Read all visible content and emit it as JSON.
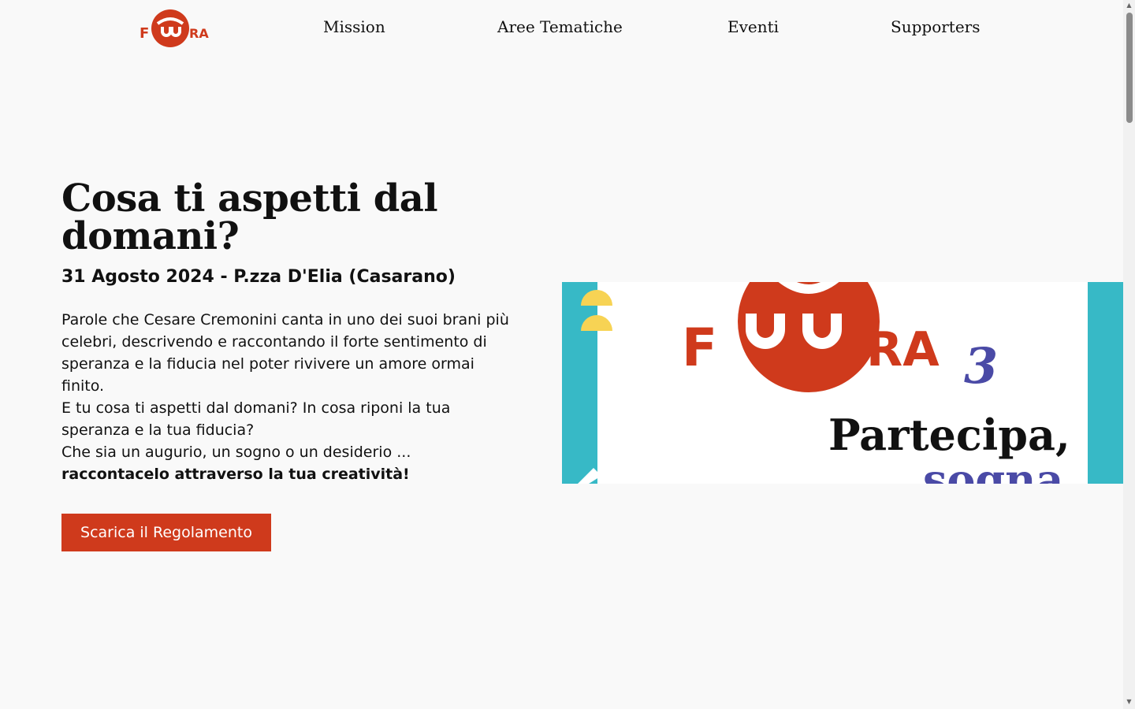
{
  "header": {
    "logo_text": "FUTURA",
    "nav": [
      {
        "label": "Mission"
      },
      {
        "label": "Aree Tematiche"
      },
      {
        "label": "Eventi"
      },
      {
        "label": "Supporters"
      }
    ]
  },
  "hero": {
    "title": "Cosa ti aspetti dal domani?",
    "subtitle": "31 Agosto 2024 - P.zza D'Elia (Casarano)",
    "paragraphs": [
      "Parole che Cesare Cremonini canta in uno dei suoi brani più celebri, descrivendo e raccontando il forte sentimento di speranza e la fiducia nel poter rivivere un amore ormai finito.",
      "E tu cosa ti aspetti dal domani? In cosa riponi la tua speranza e la tua fiducia?",
      "Che sia un augurio, un sogno o un desiderio ..."
    ],
    "emphasis": "raccontacelo attraverso la tua creatività!",
    "cta_label": "Scarica il Regolamento"
  },
  "poster": {
    "logo_text": "FUTURA",
    "edition": "3",
    "headline": "Partecipa,",
    "headline_2": "sogna"
  },
  "colors": {
    "brand_red": "#cf3a1c",
    "teal": "#37b9c6",
    "yellow": "#f7d354",
    "indigo": "#4a4aa6",
    "background": "#f9f9f9"
  },
  "icons": {
    "scroll_up": "chevron-up-icon",
    "scroll_down": "chevron-down-icon"
  }
}
